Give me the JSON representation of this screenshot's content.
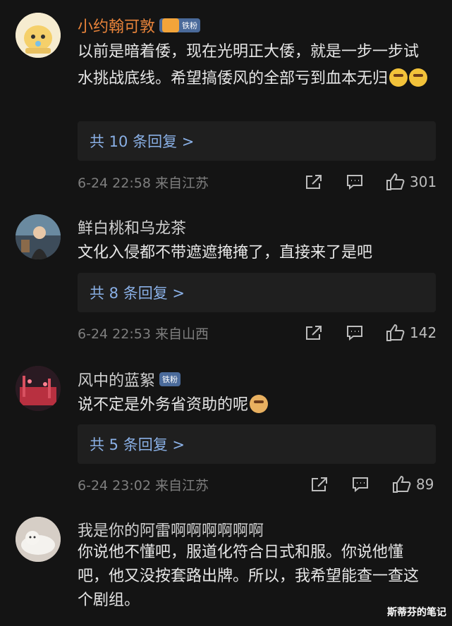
{
  "comments": [
    {
      "username": "小约翰可敦",
      "badge": "铁粉",
      "content": "以前是暗着倭，现在光明正大倭，就是一步一步试水挑战底线。希望搞倭风的全部亏到血本无归",
      "replies": "共 10 条回复 >",
      "time": "6-24 22:58 来自江苏",
      "likes": "301"
    },
    {
      "username": "鲜白桃和乌龙茶",
      "content": "文化入侵都不带遮遮掩掩了，直接来了是吧",
      "replies": "共 8 条回复 >",
      "time": "6-24 22:53 来自山西",
      "likes": "142"
    },
    {
      "username": "风中的蓝絮",
      "badge": "铁粉",
      "content": "说不定是外务省资助的呢",
      "replies": "共 5 条回复 >",
      "time": "6-24 23:02 来自江苏",
      "likes": "89"
    },
    {
      "username": "我是你的阿雷啊啊啊啊啊啊",
      "content": "你说他不懂吧，服道化符合日式和服。你说他懂吧，他又没按套路出牌。所以，我希望能查一查这个剧组。"
    }
  ],
  "watermark": "斯蒂芬的笔记",
  "colors": {
    "vip_name": "#e8833a",
    "reply_link": "#8ab0e6",
    "background": "#141414"
  }
}
